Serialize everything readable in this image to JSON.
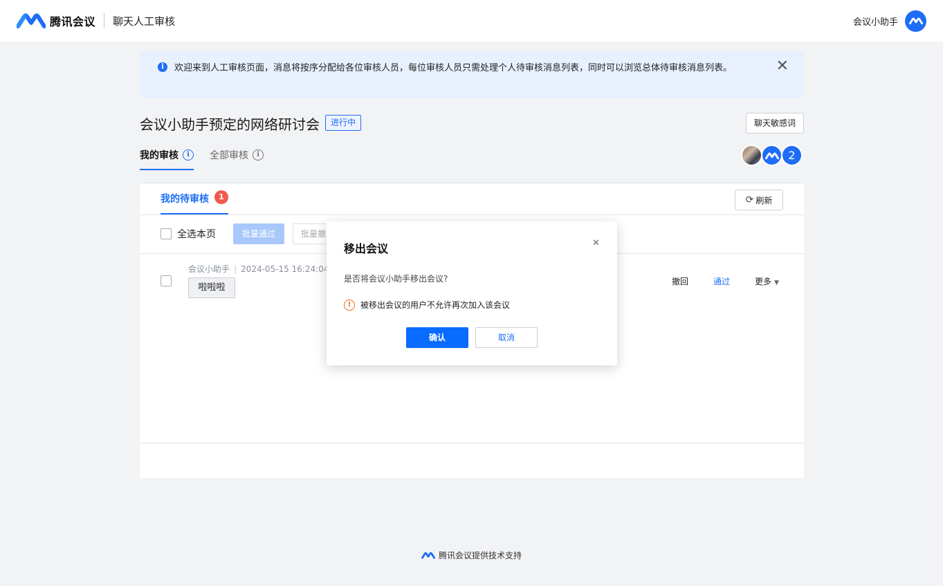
{
  "header": {
    "brand": "腾讯会议",
    "page_name": "聊天人工审核",
    "user_name": "会议小助手"
  },
  "notice": {
    "text": "欢迎来到人工审核页面，消息将按序分配给各位审核人员，每位审核人员只需处理个人待审核消息列表，同时可以浏览总体待审核消息列表。"
  },
  "meeting": {
    "title": "会议小助手预定的网络研讨会",
    "status": "进行中",
    "sensitive_words_button": "聊天敏感词"
  },
  "tabs": {
    "mine": "我的审核",
    "all": "全部审核"
  },
  "participants": {
    "extra_count": "2"
  },
  "panel": {
    "sub_tab": "我的待审核",
    "pending_count": "1",
    "refresh": "刷新",
    "select_page": "全选本页",
    "batch_approve": "批量通过",
    "batch_revoke": "批量撤回"
  },
  "message": {
    "sender": "会议小助手",
    "time": "2024-05-15 16:24:04",
    "content": "啦啦啦",
    "action_revoke": "撤回",
    "action_approve": "通过",
    "action_more": "更多"
  },
  "dialog": {
    "title": "移出会议",
    "question": "是否将会议小助手移出会议?",
    "warning": "被移出会议的用户不允许再次加入该会议",
    "confirm": "确认",
    "cancel": "取消"
  },
  "footer": {
    "text": "腾讯会议提供技术支持"
  },
  "colors": {
    "accent": "#1e6df6",
    "badge": "#f05a4f",
    "warning": "#ec6a12"
  }
}
